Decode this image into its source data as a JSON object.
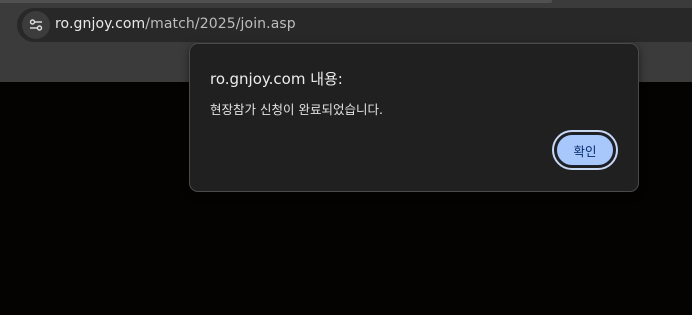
{
  "address_bar": {
    "host": "ro.gnjoy.com",
    "path": "/match/2025/join.asp",
    "site_info_icon": "tune-icon"
  },
  "dialog": {
    "title": "ro.gnjoy.com 내용:",
    "message": "현장참가 신청이 완료되었습니다.",
    "ok_label": "확인"
  },
  "colors": {
    "chrome_bg": "#3b3b3b",
    "page_bg": "#050302",
    "dialog_bg": "#202020",
    "button_bg": "#a8c7fa",
    "button_text": "#062e6f"
  }
}
